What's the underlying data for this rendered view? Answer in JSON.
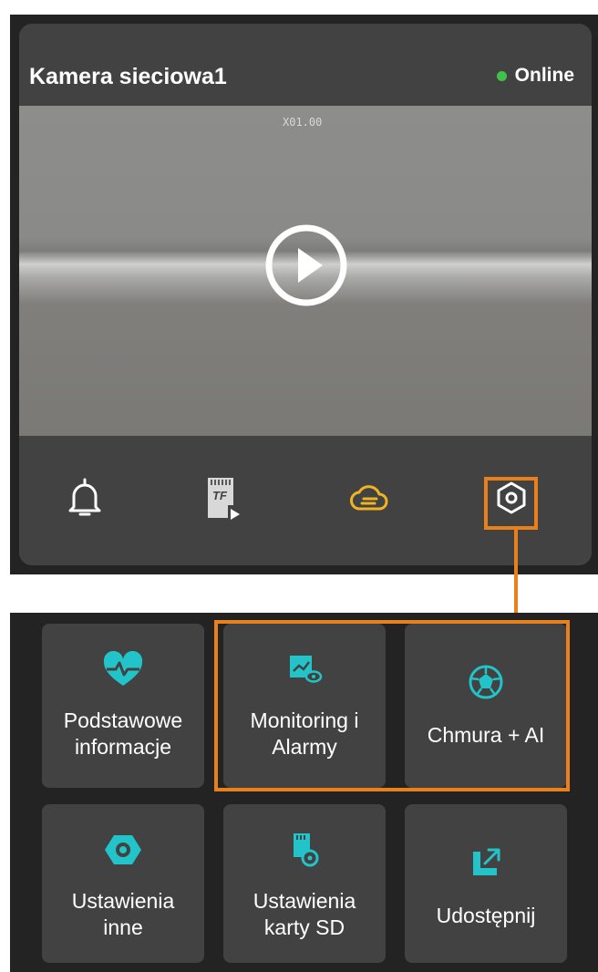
{
  "camera": {
    "name": "Kamera sieciowa1",
    "status": "Online",
    "zoom": "X01.00"
  },
  "colors": {
    "accent": "#e8801c",
    "online": "#3fc24a",
    "cloud_icon": "#f0b323",
    "tile_icon": "#22c3c9"
  },
  "toolbar": {
    "icons": [
      "bell-icon",
      "tf-card-icon",
      "cloud-storage-icon",
      "settings-icon"
    ],
    "tf_label": "TF"
  },
  "tiles": [
    {
      "label": "Podstawowe\ninformacje",
      "icon": "heart-pulse-icon"
    },
    {
      "label": "Monitoring i\nAlarmy",
      "icon": "monitor-eye-icon"
    },
    {
      "label": "Chmura + AI",
      "icon": "dodecahedron-icon"
    },
    {
      "label": "Ustawienia\ninne",
      "icon": "hex-gear-icon"
    },
    {
      "label": "Ustawienia\nkarty SD",
      "icon": "sd-card-gear-icon"
    },
    {
      "label": "Udostępnij",
      "icon": "share-icon"
    }
  ]
}
